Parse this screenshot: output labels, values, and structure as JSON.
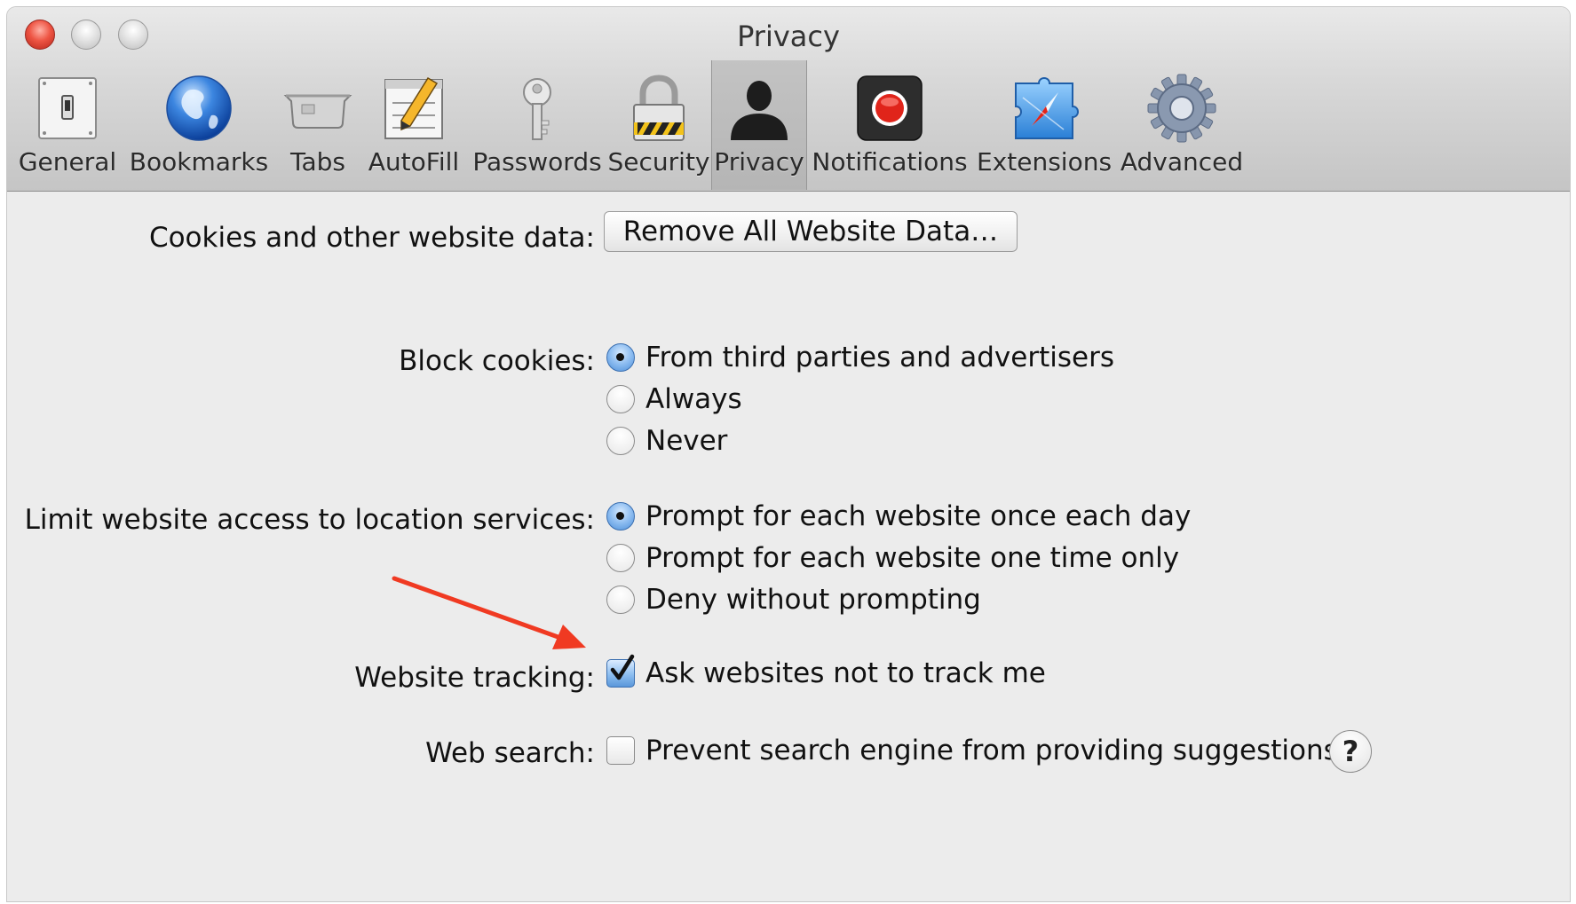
{
  "window": {
    "title": "Privacy"
  },
  "toolbar": {
    "items": [
      {
        "label": "General",
        "icon": "general-switch-icon"
      },
      {
        "label": "Bookmarks",
        "icon": "globe-icon"
      },
      {
        "label": "Tabs",
        "icon": "tabs-icon"
      },
      {
        "label": "AutoFill",
        "icon": "pencil-form-icon"
      },
      {
        "label": "Passwords",
        "icon": "key-icon"
      },
      {
        "label": "Security",
        "icon": "padlock-icon"
      },
      {
        "label": "Privacy",
        "icon": "person-silhouette-icon",
        "selected": true
      },
      {
        "label": "Notifications",
        "icon": "record-dot-icon"
      },
      {
        "label": "Extensions",
        "icon": "compass-puzzle-icon"
      },
      {
        "label": "Advanced",
        "icon": "gear-icon"
      }
    ]
  },
  "cookies": {
    "label": "Cookies and other website data:",
    "button": "Remove All Website Data…"
  },
  "block_cookies": {
    "label": "Block cookies:",
    "options": [
      {
        "label": "From third parties and advertisers",
        "checked": true
      },
      {
        "label": "Always",
        "checked": false
      },
      {
        "label": "Never",
        "checked": false
      }
    ]
  },
  "location": {
    "label": "Limit website access to location services:",
    "options": [
      {
        "label": "Prompt for each website once each day",
        "checked": true
      },
      {
        "label": "Prompt for each website one time only",
        "checked": false
      },
      {
        "label": "Deny without prompting",
        "checked": false
      }
    ]
  },
  "tracking": {
    "label": "Website tracking:",
    "checkbox_label": "Ask websites not to track me",
    "checked": true
  },
  "web_search": {
    "label": "Web search:",
    "checkbox_label": "Prevent search engine from providing suggestions",
    "checked": false,
    "help": "?"
  },
  "colors": {
    "annotation_arrow": "#f03a22",
    "selection_blue": "#4d8fd9"
  }
}
